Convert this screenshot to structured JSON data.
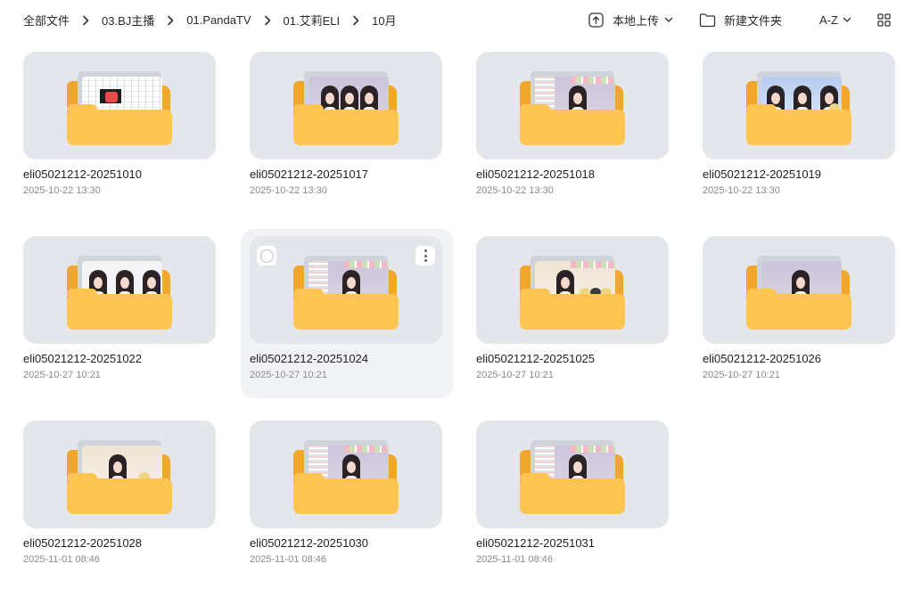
{
  "breadcrumbs": [
    "全部文件",
    "03.BJ主播",
    "01.PandaTV",
    "01.艾莉ELI",
    "10月"
  ],
  "actions": {
    "upload_label": "本地上传",
    "new_folder_label": "新建文件夹",
    "sort_label": "A-Z"
  },
  "icons": {
    "upload": "upload-icon",
    "new_folder": "new-folder-icon",
    "sort": "chevron-down-icon",
    "view": "grid-view-icon",
    "separator": "chevron-right-icon"
  },
  "colors": {
    "folder_front": "#ffc552",
    "folder_back": "#f1a72e",
    "thumb_bg": "#e3e6ea",
    "hover_bg": "#f1f3f6"
  },
  "folders": [
    {
      "name": "eli05021212-20251010",
      "date": "2025-10-22 13:30",
      "preview": "grid"
    },
    {
      "name": "eli05021212-20251017",
      "date": "2025-10-22 13:30",
      "preview": "trio-lilac"
    },
    {
      "name": "eli05021212-20251018",
      "date": "2025-10-22 13:30",
      "preview": "solo-overlay"
    },
    {
      "name": "eli05021212-20251019",
      "date": "2025-10-22 13:30",
      "preview": "trio-blue"
    },
    {
      "name": "eli05021212-20251022",
      "date": "2025-10-27 10:21",
      "preview": "trio-white"
    },
    {
      "name": "eli05021212-20251024",
      "date": "2025-10-27 10:21",
      "preview": "solo-overlay",
      "hovered": true
    },
    {
      "name": "eli05021212-20251025",
      "date": "2025-10-27 10:21",
      "preview": "solo-plush"
    },
    {
      "name": "eli05021212-20251026",
      "date": "2025-10-27 10:21",
      "preview": "solo-lilac"
    },
    {
      "name": "eli05021212-20251028",
      "date": "2025-11-01 08:46",
      "preview": "solo-beige"
    },
    {
      "name": "eli05021212-20251030",
      "date": "2025-11-01 08:46",
      "preview": "solo-overlay"
    },
    {
      "name": "eli05021212-20251031",
      "date": "2025-11-01 08:46",
      "preview": "solo-overlay"
    }
  ]
}
